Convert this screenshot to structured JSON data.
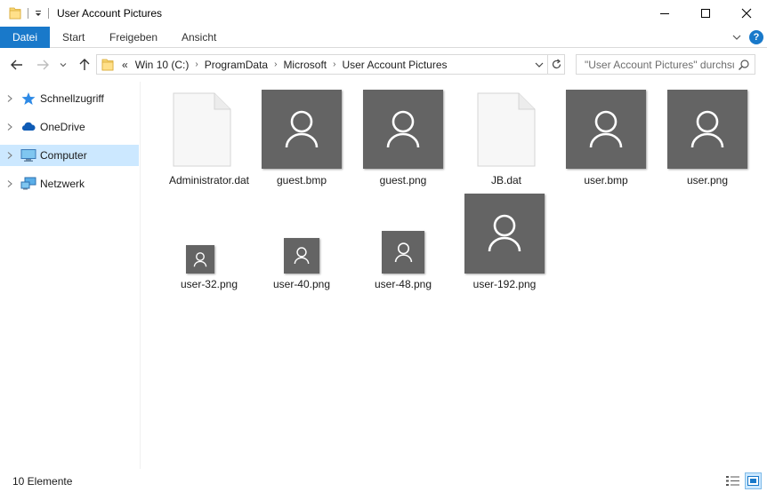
{
  "window": {
    "title": "User Account Pictures"
  },
  "ribbon": {
    "tabs": [
      {
        "label": "Datei"
      },
      {
        "label": "Start"
      },
      {
        "label": "Freigeben"
      },
      {
        "label": "Ansicht"
      }
    ],
    "help_label": "?"
  },
  "address": {
    "overflow": "«",
    "crumbs": [
      "Win 10 (C:)",
      "ProgramData",
      "Microsoft",
      "User Account Pictures"
    ]
  },
  "search": {
    "placeholder": "\"User Account Pictures\" durchsuchen"
  },
  "navpane": {
    "items": [
      {
        "label": "Schnellzugriff",
        "icon": "star-icon"
      },
      {
        "label": "OneDrive",
        "icon": "cloud-icon"
      },
      {
        "label": "Computer",
        "icon": "computer-icon",
        "selected": true
      },
      {
        "label": "Netzwerk",
        "icon": "network-icon"
      }
    ]
  },
  "files": [
    {
      "name": "Administrator.dat",
      "kind": "document"
    },
    {
      "name": "guest.bmp",
      "kind": "user-image"
    },
    {
      "name": "guest.png",
      "kind": "user-image"
    },
    {
      "name": "JB.dat",
      "kind": "document"
    },
    {
      "name": "user.bmp",
      "kind": "user-image"
    },
    {
      "name": "user.png",
      "kind": "user-image"
    },
    {
      "name": "user-32.png",
      "kind": "user-image"
    },
    {
      "name": "user-40.png",
      "kind": "user-image"
    },
    {
      "name": "user-48.png",
      "kind": "user-image"
    },
    {
      "name": "user-192.png",
      "kind": "user-image"
    }
  ],
  "status": {
    "item_count": "10 Elemente"
  },
  "colors": {
    "accent": "#1979ca",
    "selection": "#cce8ff",
    "thumbnail": "#646464"
  }
}
